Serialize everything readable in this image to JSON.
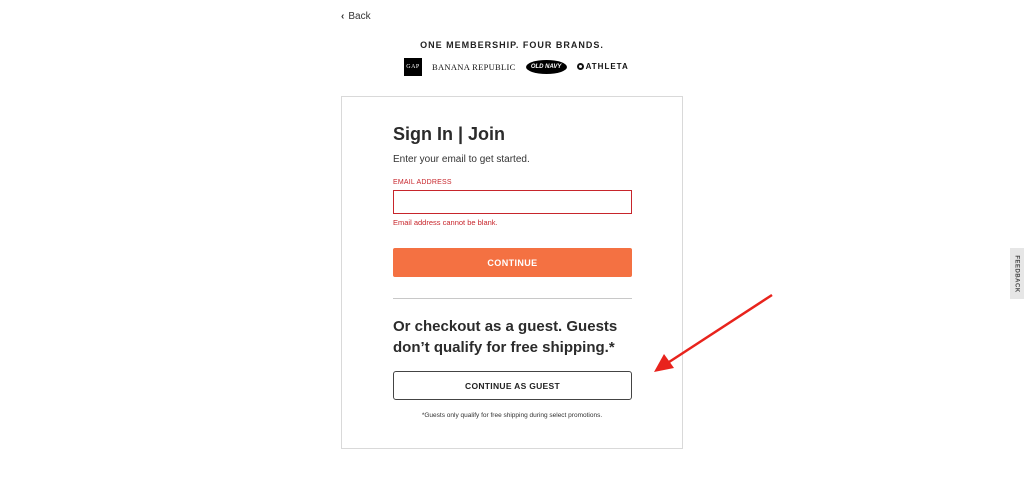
{
  "nav": {
    "back_label": "Back"
  },
  "header": {
    "tagline": "ONE MEMBERSHIP. FOUR BRANDS.",
    "brands": {
      "gap": "GAP",
      "banana_republic": "BANANA REPUBLIC",
      "old_navy": "OLD NAVY",
      "athleta": "ATHLETA"
    }
  },
  "signin": {
    "title": "Sign In | Join",
    "subtitle": "Enter your email to get started.",
    "email_label": "EMAIL ADDRESS",
    "email_value": "",
    "email_error": "Email address cannot be blank.",
    "continue_label": "CONTINUE"
  },
  "guest": {
    "heading": "Or checkout as a guest. Guests don’t qualify for free shipping.*",
    "button_label": "CONTINUE AS GUEST",
    "note": "*Guests only qualify for free shipping during select promotions."
  },
  "feedback": {
    "label": "FEEDBACK"
  },
  "colors": {
    "accent": "#f47142",
    "error": "#c7252b",
    "annotation_arrow": "#e8231c"
  }
}
